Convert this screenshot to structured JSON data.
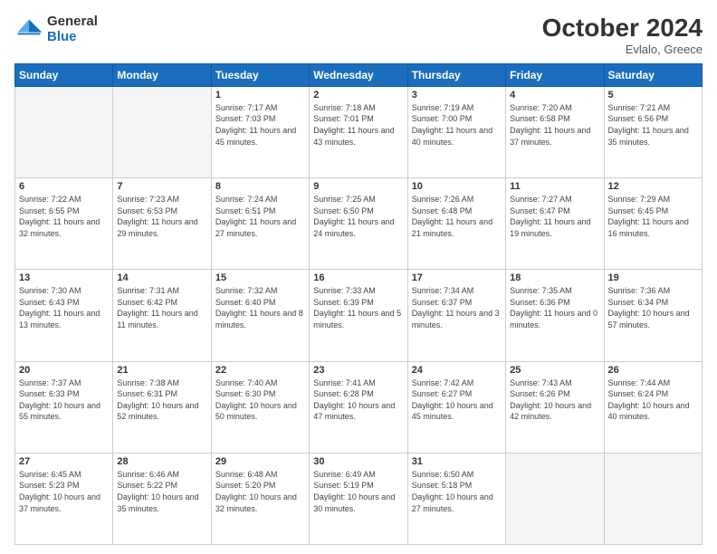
{
  "header": {
    "logo_general": "General",
    "logo_blue": "Blue",
    "month": "October 2024",
    "location": "Evlalo, Greece"
  },
  "weekdays": [
    "Sunday",
    "Monday",
    "Tuesday",
    "Wednesday",
    "Thursday",
    "Friday",
    "Saturday"
  ],
  "weeks": [
    [
      {
        "day": "",
        "sunrise": "",
        "sunset": "",
        "daylight": ""
      },
      {
        "day": "",
        "sunrise": "",
        "sunset": "",
        "daylight": ""
      },
      {
        "day": "1",
        "sunrise": "Sunrise: 7:17 AM",
        "sunset": "Sunset: 7:03 PM",
        "daylight": "Daylight: 11 hours and 45 minutes."
      },
      {
        "day": "2",
        "sunrise": "Sunrise: 7:18 AM",
        "sunset": "Sunset: 7:01 PM",
        "daylight": "Daylight: 11 hours and 43 minutes."
      },
      {
        "day": "3",
        "sunrise": "Sunrise: 7:19 AM",
        "sunset": "Sunset: 7:00 PM",
        "daylight": "Daylight: 11 hours and 40 minutes."
      },
      {
        "day": "4",
        "sunrise": "Sunrise: 7:20 AM",
        "sunset": "Sunset: 6:58 PM",
        "daylight": "Daylight: 11 hours and 37 minutes."
      },
      {
        "day": "5",
        "sunrise": "Sunrise: 7:21 AM",
        "sunset": "Sunset: 6:56 PM",
        "daylight": "Daylight: 11 hours and 35 minutes."
      }
    ],
    [
      {
        "day": "6",
        "sunrise": "Sunrise: 7:22 AM",
        "sunset": "Sunset: 6:55 PM",
        "daylight": "Daylight: 11 hours and 32 minutes."
      },
      {
        "day": "7",
        "sunrise": "Sunrise: 7:23 AM",
        "sunset": "Sunset: 6:53 PM",
        "daylight": "Daylight: 11 hours and 29 minutes."
      },
      {
        "day": "8",
        "sunrise": "Sunrise: 7:24 AM",
        "sunset": "Sunset: 6:51 PM",
        "daylight": "Daylight: 11 hours and 27 minutes."
      },
      {
        "day": "9",
        "sunrise": "Sunrise: 7:25 AM",
        "sunset": "Sunset: 6:50 PM",
        "daylight": "Daylight: 11 hours and 24 minutes."
      },
      {
        "day": "10",
        "sunrise": "Sunrise: 7:26 AM",
        "sunset": "Sunset: 6:48 PM",
        "daylight": "Daylight: 11 hours and 21 minutes."
      },
      {
        "day": "11",
        "sunrise": "Sunrise: 7:27 AM",
        "sunset": "Sunset: 6:47 PM",
        "daylight": "Daylight: 11 hours and 19 minutes."
      },
      {
        "day": "12",
        "sunrise": "Sunrise: 7:29 AM",
        "sunset": "Sunset: 6:45 PM",
        "daylight": "Daylight: 11 hours and 16 minutes."
      }
    ],
    [
      {
        "day": "13",
        "sunrise": "Sunrise: 7:30 AM",
        "sunset": "Sunset: 6:43 PM",
        "daylight": "Daylight: 11 hours and 13 minutes."
      },
      {
        "day": "14",
        "sunrise": "Sunrise: 7:31 AM",
        "sunset": "Sunset: 6:42 PM",
        "daylight": "Daylight: 11 hours and 11 minutes."
      },
      {
        "day": "15",
        "sunrise": "Sunrise: 7:32 AM",
        "sunset": "Sunset: 6:40 PM",
        "daylight": "Daylight: 11 hours and 8 minutes."
      },
      {
        "day": "16",
        "sunrise": "Sunrise: 7:33 AM",
        "sunset": "Sunset: 6:39 PM",
        "daylight": "Daylight: 11 hours and 5 minutes."
      },
      {
        "day": "17",
        "sunrise": "Sunrise: 7:34 AM",
        "sunset": "Sunset: 6:37 PM",
        "daylight": "Daylight: 11 hours and 3 minutes."
      },
      {
        "day": "18",
        "sunrise": "Sunrise: 7:35 AM",
        "sunset": "Sunset: 6:36 PM",
        "daylight": "Daylight: 11 hours and 0 minutes."
      },
      {
        "day": "19",
        "sunrise": "Sunrise: 7:36 AM",
        "sunset": "Sunset: 6:34 PM",
        "daylight": "Daylight: 10 hours and 57 minutes."
      }
    ],
    [
      {
        "day": "20",
        "sunrise": "Sunrise: 7:37 AM",
        "sunset": "Sunset: 6:33 PM",
        "daylight": "Daylight: 10 hours and 55 minutes."
      },
      {
        "day": "21",
        "sunrise": "Sunrise: 7:38 AM",
        "sunset": "Sunset: 6:31 PM",
        "daylight": "Daylight: 10 hours and 52 minutes."
      },
      {
        "day": "22",
        "sunrise": "Sunrise: 7:40 AM",
        "sunset": "Sunset: 6:30 PM",
        "daylight": "Daylight: 10 hours and 50 minutes."
      },
      {
        "day": "23",
        "sunrise": "Sunrise: 7:41 AM",
        "sunset": "Sunset: 6:28 PM",
        "daylight": "Daylight: 10 hours and 47 minutes."
      },
      {
        "day": "24",
        "sunrise": "Sunrise: 7:42 AM",
        "sunset": "Sunset: 6:27 PM",
        "daylight": "Daylight: 10 hours and 45 minutes."
      },
      {
        "day": "25",
        "sunrise": "Sunrise: 7:43 AM",
        "sunset": "Sunset: 6:26 PM",
        "daylight": "Daylight: 10 hours and 42 minutes."
      },
      {
        "day": "26",
        "sunrise": "Sunrise: 7:44 AM",
        "sunset": "Sunset: 6:24 PM",
        "daylight": "Daylight: 10 hours and 40 minutes."
      }
    ],
    [
      {
        "day": "27",
        "sunrise": "Sunrise: 6:45 AM",
        "sunset": "Sunset: 5:23 PM",
        "daylight": "Daylight: 10 hours and 37 minutes."
      },
      {
        "day": "28",
        "sunrise": "Sunrise: 6:46 AM",
        "sunset": "Sunset: 5:22 PM",
        "daylight": "Daylight: 10 hours and 35 minutes."
      },
      {
        "day": "29",
        "sunrise": "Sunrise: 6:48 AM",
        "sunset": "Sunset: 5:20 PM",
        "daylight": "Daylight: 10 hours and 32 minutes."
      },
      {
        "day": "30",
        "sunrise": "Sunrise: 6:49 AM",
        "sunset": "Sunset: 5:19 PM",
        "daylight": "Daylight: 10 hours and 30 minutes."
      },
      {
        "day": "31",
        "sunrise": "Sunrise: 6:50 AM",
        "sunset": "Sunset: 5:18 PM",
        "daylight": "Daylight: 10 hours and 27 minutes."
      },
      {
        "day": "",
        "sunrise": "",
        "sunset": "",
        "daylight": ""
      },
      {
        "day": "",
        "sunrise": "",
        "sunset": "",
        "daylight": ""
      }
    ]
  ]
}
